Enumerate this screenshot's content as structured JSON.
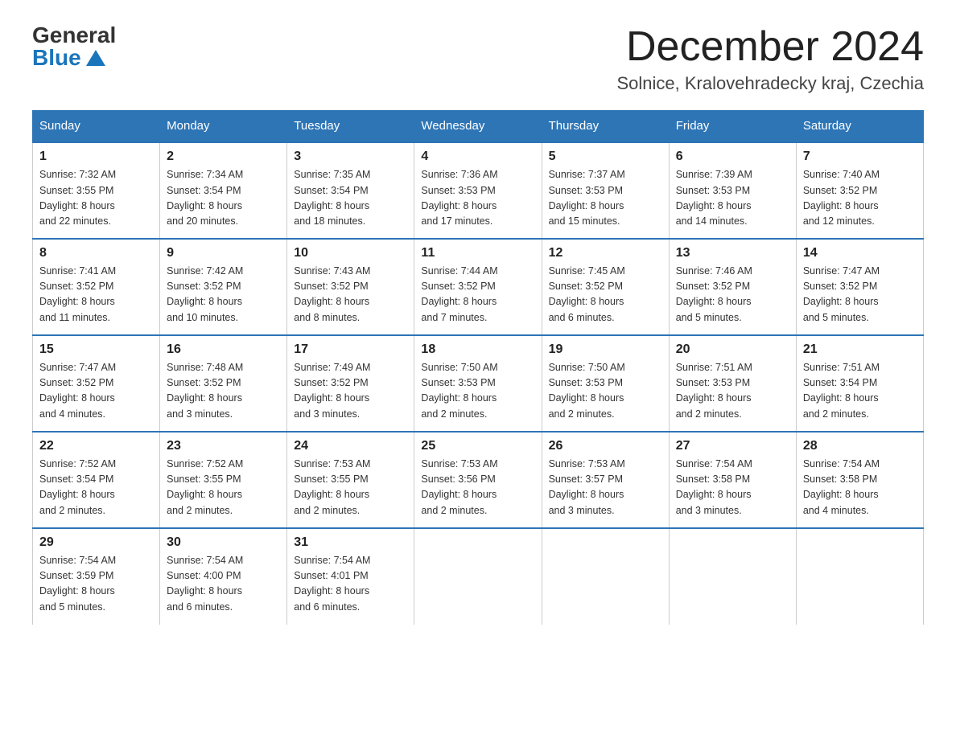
{
  "logo": {
    "general": "General",
    "blue": "Blue"
  },
  "title": "December 2024",
  "location": "Solnice, Kralovehradecky kraj, Czechia",
  "days_of_week": [
    "Sunday",
    "Monday",
    "Tuesday",
    "Wednesday",
    "Thursday",
    "Friday",
    "Saturday"
  ],
  "weeks": [
    [
      {
        "day": "1",
        "sunrise": "7:32 AM",
        "sunset": "3:55 PM",
        "daylight": "8 hours and 22 minutes."
      },
      {
        "day": "2",
        "sunrise": "7:34 AM",
        "sunset": "3:54 PM",
        "daylight": "8 hours and 20 minutes."
      },
      {
        "day": "3",
        "sunrise": "7:35 AM",
        "sunset": "3:54 PM",
        "daylight": "8 hours and 18 minutes."
      },
      {
        "day": "4",
        "sunrise": "7:36 AM",
        "sunset": "3:53 PM",
        "daylight": "8 hours and 17 minutes."
      },
      {
        "day": "5",
        "sunrise": "7:37 AM",
        "sunset": "3:53 PM",
        "daylight": "8 hours and 15 minutes."
      },
      {
        "day": "6",
        "sunrise": "7:39 AM",
        "sunset": "3:53 PM",
        "daylight": "8 hours and 14 minutes."
      },
      {
        "day": "7",
        "sunrise": "7:40 AM",
        "sunset": "3:52 PM",
        "daylight": "8 hours and 12 minutes."
      }
    ],
    [
      {
        "day": "8",
        "sunrise": "7:41 AM",
        "sunset": "3:52 PM",
        "daylight": "8 hours and 11 minutes."
      },
      {
        "day": "9",
        "sunrise": "7:42 AM",
        "sunset": "3:52 PM",
        "daylight": "8 hours and 10 minutes."
      },
      {
        "day": "10",
        "sunrise": "7:43 AM",
        "sunset": "3:52 PM",
        "daylight": "8 hours and 8 minutes."
      },
      {
        "day": "11",
        "sunrise": "7:44 AM",
        "sunset": "3:52 PM",
        "daylight": "8 hours and 7 minutes."
      },
      {
        "day": "12",
        "sunrise": "7:45 AM",
        "sunset": "3:52 PM",
        "daylight": "8 hours and 6 minutes."
      },
      {
        "day": "13",
        "sunrise": "7:46 AM",
        "sunset": "3:52 PM",
        "daylight": "8 hours and 5 minutes."
      },
      {
        "day": "14",
        "sunrise": "7:47 AM",
        "sunset": "3:52 PM",
        "daylight": "8 hours and 5 minutes."
      }
    ],
    [
      {
        "day": "15",
        "sunrise": "7:47 AM",
        "sunset": "3:52 PM",
        "daylight": "8 hours and 4 minutes."
      },
      {
        "day": "16",
        "sunrise": "7:48 AM",
        "sunset": "3:52 PM",
        "daylight": "8 hours and 3 minutes."
      },
      {
        "day": "17",
        "sunrise": "7:49 AM",
        "sunset": "3:52 PM",
        "daylight": "8 hours and 3 minutes."
      },
      {
        "day": "18",
        "sunrise": "7:50 AM",
        "sunset": "3:53 PM",
        "daylight": "8 hours and 2 minutes."
      },
      {
        "day": "19",
        "sunrise": "7:50 AM",
        "sunset": "3:53 PM",
        "daylight": "8 hours and 2 minutes."
      },
      {
        "day": "20",
        "sunrise": "7:51 AM",
        "sunset": "3:53 PM",
        "daylight": "8 hours and 2 minutes."
      },
      {
        "day": "21",
        "sunrise": "7:51 AM",
        "sunset": "3:54 PM",
        "daylight": "8 hours and 2 minutes."
      }
    ],
    [
      {
        "day": "22",
        "sunrise": "7:52 AM",
        "sunset": "3:54 PM",
        "daylight": "8 hours and 2 minutes."
      },
      {
        "day": "23",
        "sunrise": "7:52 AM",
        "sunset": "3:55 PM",
        "daylight": "8 hours and 2 minutes."
      },
      {
        "day": "24",
        "sunrise": "7:53 AM",
        "sunset": "3:55 PM",
        "daylight": "8 hours and 2 minutes."
      },
      {
        "day": "25",
        "sunrise": "7:53 AM",
        "sunset": "3:56 PM",
        "daylight": "8 hours and 2 minutes."
      },
      {
        "day": "26",
        "sunrise": "7:53 AM",
        "sunset": "3:57 PM",
        "daylight": "8 hours and 3 minutes."
      },
      {
        "day": "27",
        "sunrise": "7:54 AM",
        "sunset": "3:58 PM",
        "daylight": "8 hours and 3 minutes."
      },
      {
        "day": "28",
        "sunrise": "7:54 AM",
        "sunset": "3:58 PM",
        "daylight": "8 hours and 4 minutes."
      }
    ],
    [
      {
        "day": "29",
        "sunrise": "7:54 AM",
        "sunset": "3:59 PM",
        "daylight": "8 hours and 5 minutes."
      },
      {
        "day": "30",
        "sunrise": "7:54 AM",
        "sunset": "4:00 PM",
        "daylight": "8 hours and 6 minutes."
      },
      {
        "day": "31",
        "sunrise": "7:54 AM",
        "sunset": "4:01 PM",
        "daylight": "8 hours and 6 minutes."
      },
      null,
      null,
      null,
      null
    ]
  ],
  "labels": {
    "sunrise": "Sunrise:",
    "sunset": "Sunset:",
    "daylight": "Daylight:"
  }
}
